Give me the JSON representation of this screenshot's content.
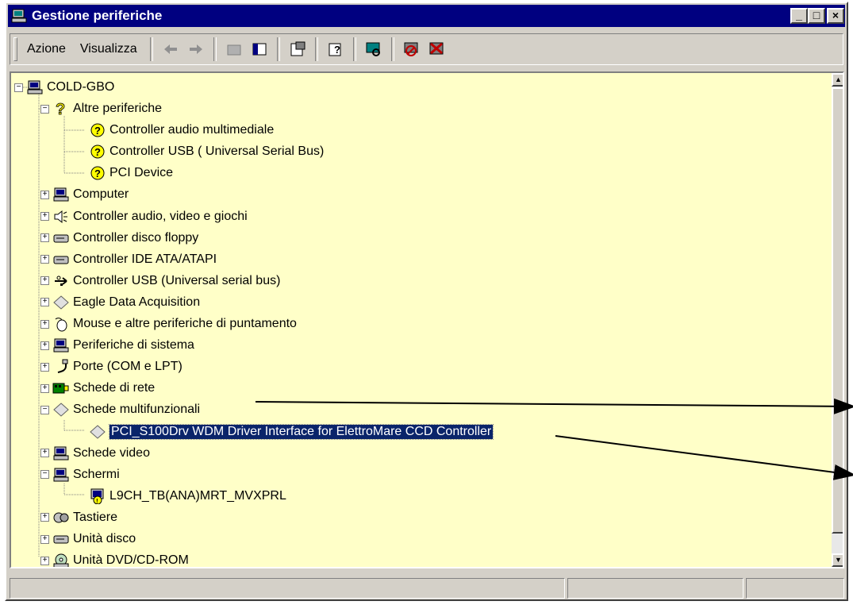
{
  "window": {
    "title": "Gestione periferiche",
    "controls": [
      "minimize",
      "maximize",
      "close"
    ]
  },
  "menu": {
    "azione": "Azione",
    "visualizza": "Visualizza"
  },
  "toolbar": {
    "icons": [
      "back-icon",
      "forward-icon",
      "up-folder-icon",
      "show-hide-tree-icon",
      "properties-icon",
      "help-icon",
      "scan-hardware-icon",
      "disable-device-icon",
      "uninstall-device-icon"
    ]
  },
  "tree": {
    "root": "COLD-GBO",
    "items": [
      {
        "label": "Altre periferiche",
        "level": 1,
        "expanded": true
      },
      {
        "label": "Controller audio multimediale",
        "level": 2
      },
      {
        "label": "Controller USB ( Universal Serial Bus)",
        "level": 2
      },
      {
        "label": "PCI Device",
        "level": 2
      },
      {
        "label": "Computer",
        "level": 1
      },
      {
        "label": "Controller audio, video e giochi",
        "level": 1
      },
      {
        "label": "Controller disco floppy",
        "level": 1
      },
      {
        "label": "Controller IDE ATA/ATAPI",
        "level": 1
      },
      {
        "label": "Controller USB (Universal serial bus)",
        "level": 1
      },
      {
        "label": "Eagle Data Acquisition",
        "level": 1
      },
      {
        "label": "Mouse e altre periferiche di puntamento",
        "level": 1
      },
      {
        "label": "Periferiche di sistema",
        "level": 1
      },
      {
        "label": "Porte (COM e LPT)",
        "level": 1
      },
      {
        "label": "Schede di rete",
        "level": 1
      },
      {
        "label": "Schede multifunzionali",
        "level": 1,
        "expanded": true
      },
      {
        "label": "PCI_S100Drv WDM Driver Interface for ElettroMare CCD Controller",
        "level": 2,
        "selected": true
      },
      {
        "label": "Schede video",
        "level": 1
      },
      {
        "label": "Schermi",
        "level": 1,
        "expanded": true
      },
      {
        "label": "L9CH_TB(ANA)MRT_MVXPRL",
        "level": 2
      },
      {
        "label": "Tastiere",
        "level": 1
      },
      {
        "label": "Unità disco",
        "level": 1
      },
      {
        "label": "Unità DVD/CD-ROM",
        "level": 1
      }
    ]
  },
  "colors": {
    "titlebar": "#000080",
    "tree_background": "#ffffc8",
    "selection": "#0a246a"
  }
}
